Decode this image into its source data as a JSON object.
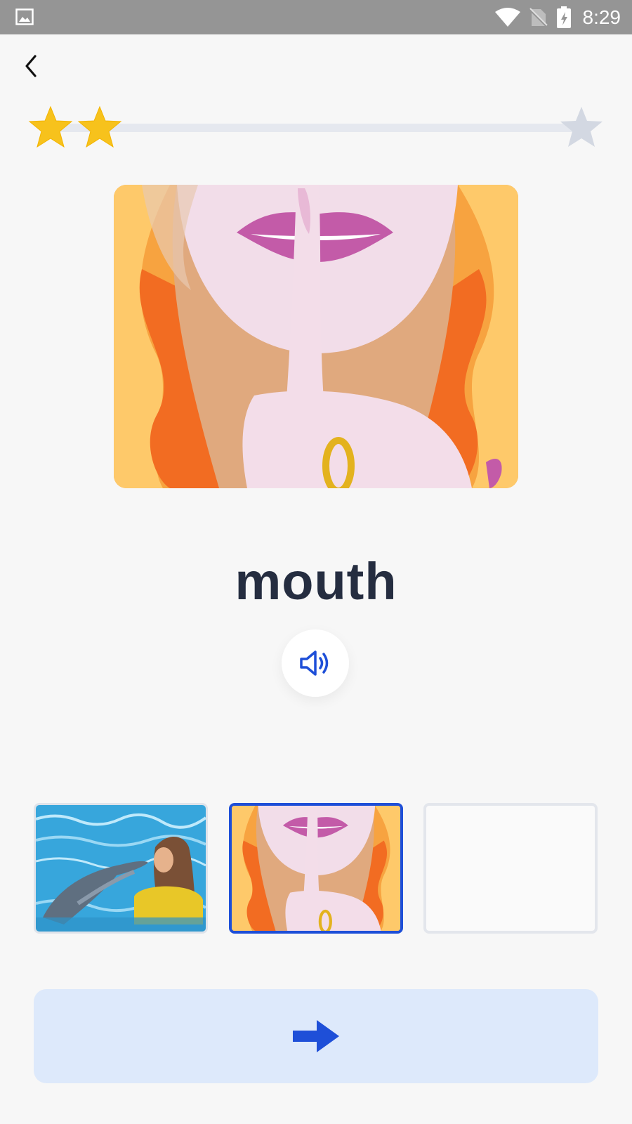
{
  "status_bar": {
    "time": "8:29",
    "icons": [
      "gallery-icon",
      "wifi-icon",
      "no-sim-icon",
      "battery-charging-icon"
    ]
  },
  "header": {
    "back_icon": "chevron-left-icon"
  },
  "progress": {
    "stars_total": 3,
    "stars_filled": 2,
    "filled_color": "#f7c21c",
    "empty_color": "#d3d8e2"
  },
  "card": {
    "image": "woman-finger-on-lips-illustration",
    "word": "mouth"
  },
  "audio": {
    "icon": "speaker-icon",
    "color": "#1e4fd8"
  },
  "options": [
    {
      "image": "woman-kissing-dolphin-photo",
      "selected": false
    },
    {
      "image": "woman-finger-on-lips-illustration",
      "selected": true
    },
    {
      "image": "empty",
      "selected": false
    }
  ],
  "next": {
    "icon": "arrow-right-icon",
    "background": "#dde9fb",
    "color": "#1e4fd8"
  }
}
